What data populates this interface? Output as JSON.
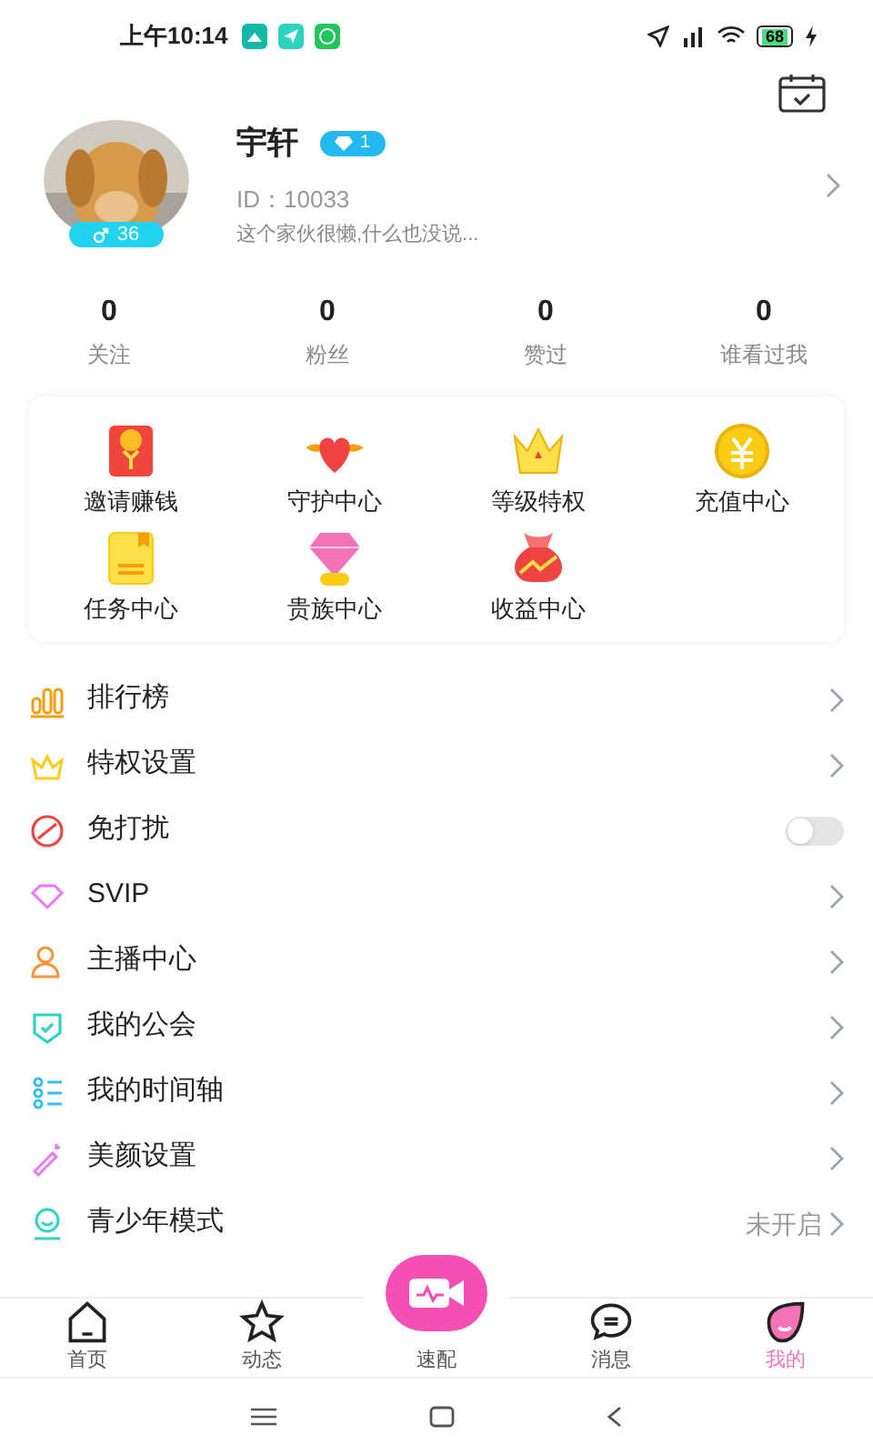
{
  "status_bar": {
    "time": "上午10:14",
    "battery": "68"
  },
  "profile": {
    "name": "宇轩",
    "level": "1",
    "id": "ID：10033",
    "bio": "这个家伙很懒,什么也没说...",
    "age": "36"
  },
  "stats": [
    {
      "value": "0",
      "label": "关注"
    },
    {
      "value": "0",
      "label": "粉丝"
    },
    {
      "value": "0",
      "label": "赞过"
    },
    {
      "value": "0",
      "label": "谁看过我"
    }
  ],
  "features": [
    {
      "label": "邀请赚钱"
    },
    {
      "label": "守护中心"
    },
    {
      "label": "等级特权"
    },
    {
      "label": "充值中心"
    },
    {
      "label": "任务中心"
    },
    {
      "label": "贵族中心"
    },
    {
      "label": "收益中心"
    }
  ],
  "menu": [
    {
      "kind": "link",
      "label": "排行榜"
    },
    {
      "kind": "link",
      "label": "特权设置"
    },
    {
      "kind": "toggle",
      "label": "免打扰",
      "on": false
    },
    {
      "kind": "link",
      "label": "SVIP"
    },
    {
      "kind": "link",
      "label": "主播中心"
    },
    {
      "kind": "link",
      "label": "我的公会"
    },
    {
      "kind": "link",
      "label": "我的时间轴"
    },
    {
      "kind": "link",
      "label": "美颜设置"
    },
    {
      "kind": "value",
      "label": "青少年模式",
      "value": "未开启"
    }
  ],
  "tabs": [
    {
      "label": "首页",
      "selected": false
    },
    {
      "label": "动态",
      "selected": false
    },
    {
      "label": "速配",
      "selected": false
    },
    {
      "label": "消息",
      "selected": false
    },
    {
      "label": "我的",
      "selected": true
    }
  ]
}
